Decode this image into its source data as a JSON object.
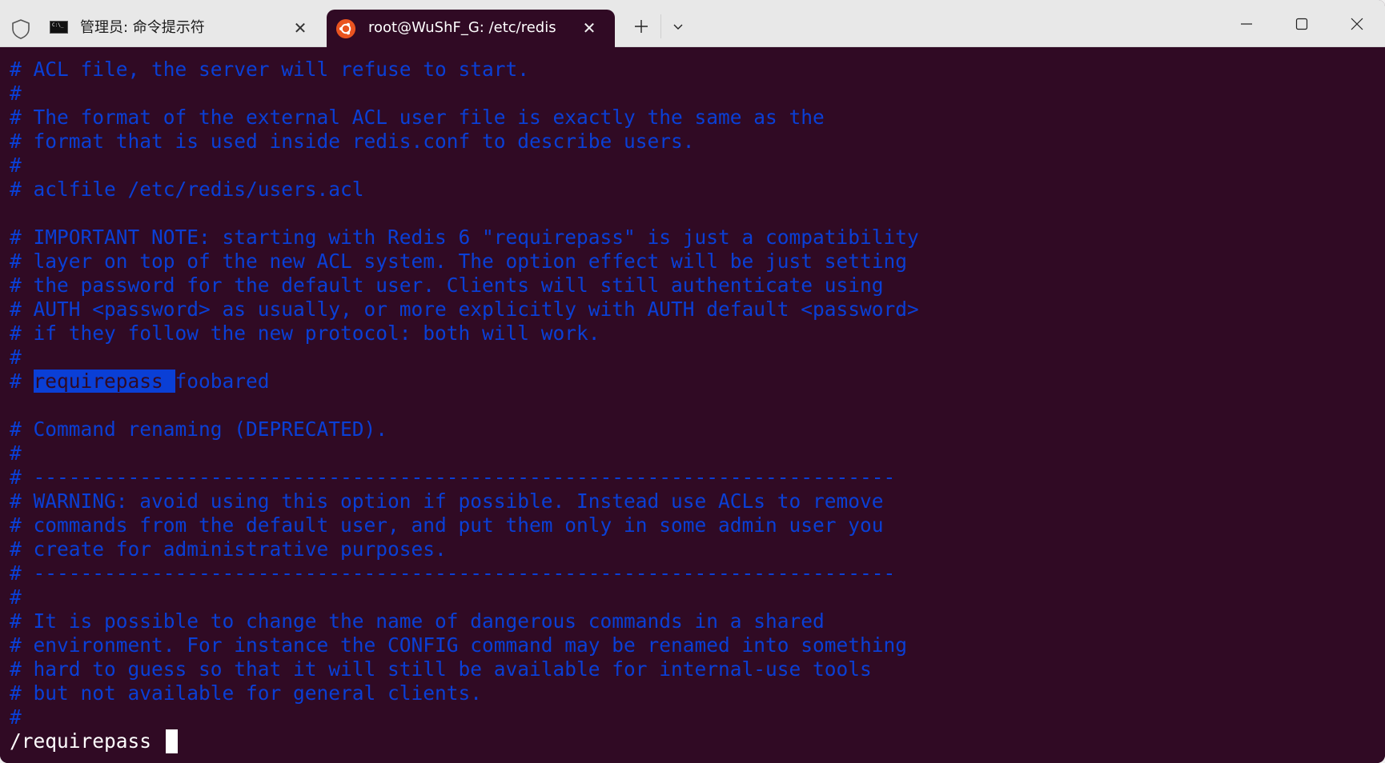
{
  "window": {
    "title_bar": {
      "tabs": [
        {
          "label": "管理员: 命令提示符",
          "icon": "cmd-icon",
          "active": false
        },
        {
          "label": "root@WuShF_G: /etc/redis",
          "icon": "ubuntu-icon",
          "active": true
        }
      ],
      "new_tab_label": "+",
      "dropdown_label": "⌄",
      "close_tab_label": "✕"
    },
    "colors": {
      "terminal_bg": "#300a24",
      "comment_text": "#0a3fd6",
      "prompt_text": "#ffffff",
      "titlebar_bg": "#e8e8e8",
      "ubuntu_orange": "#e95420"
    }
  },
  "terminal": {
    "lines": [
      "# ACL file, the server will refuse to start.",
      "#",
      "# The format of the external ACL user file is exactly the same as the",
      "# format that is used inside redis.conf to describe users.",
      "#",
      "# aclfile /etc/redis/users.acl",
      "",
      "# IMPORTANT NOTE: starting with Redis 6 \"requirepass\" is just a compatibility",
      "# layer on top of the new ACL system. The option effect will be just setting",
      "# the password for the default user. Clients will still authenticate using",
      "# AUTH <password> as usually, or more explicitly with AUTH default <password>",
      "# if they follow the new protocol: both will work.",
      "#",
      "# requirepass foobared",
      "",
      "# Command renaming (DEPRECATED).",
      "#",
      "# -------------------------------------------------------------------------",
      "# WARNING: avoid using this option if possible. Instead use ACLs to remove",
      "# commands from the default user, and put them only in some admin user you",
      "# create for administrative purposes.",
      "# -------------------------------------------------------------------------",
      "#",
      "# It is possible to change the name of dangerous commands in a shared",
      "# environment. For instance the CONFIG command may be renamed into something",
      "# hard to guess so that it will still be available for internal-use tools",
      "# but not available for general clients.",
      "#"
    ],
    "highlight": {
      "line_index": 13,
      "prefix": "# ",
      "match": "requirepass ",
      "suffix": "foobared"
    },
    "command_line": "/requirepass "
  }
}
